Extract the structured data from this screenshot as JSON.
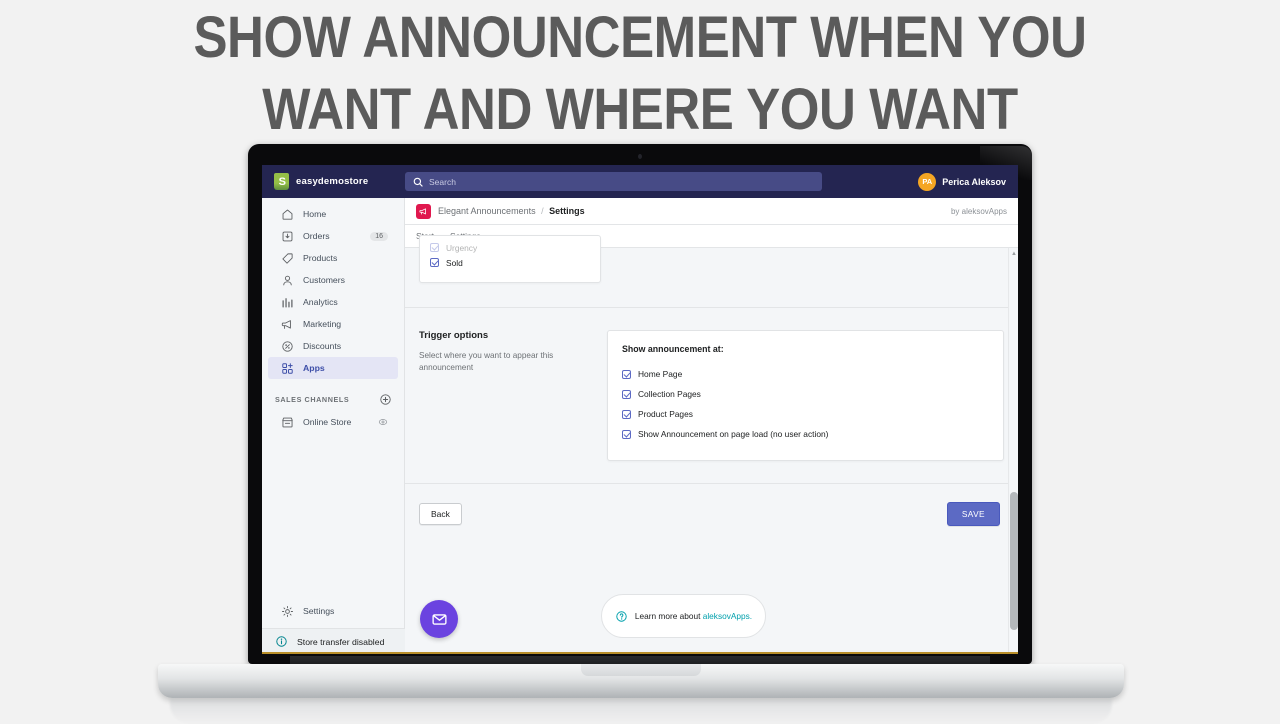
{
  "headline": {
    "line1": "SHOW ANNOUNCEMENT WHEN YOU",
    "line2": "WANT AND WHERE YOU WANT",
    "color": "#5b5b5b"
  },
  "topbar": {
    "brand_name": "easydemostore",
    "logo_icon": "shopify-bag-icon",
    "search": {
      "icon": "search-icon",
      "placeholder": "Search",
      "value": ""
    },
    "user": {
      "initials": "PA",
      "name": "Perica Aleksov",
      "avatar_color": "#f5a623"
    },
    "background": "#242551",
    "search_background": "#474b86"
  },
  "sidebar": {
    "items": [
      {
        "label": "Home",
        "icon": "home-icon",
        "badge": "",
        "active": false
      },
      {
        "label": "Orders",
        "icon": "orders-icon",
        "badge": "16",
        "active": false
      },
      {
        "label": "Products",
        "icon": "products-tag-icon",
        "badge": "",
        "active": false
      },
      {
        "label": "Customers",
        "icon": "customers-icon",
        "badge": "",
        "active": false
      },
      {
        "label": "Analytics",
        "icon": "analytics-bars-icon",
        "badge": "",
        "active": false
      },
      {
        "label": "Marketing",
        "icon": "marketing-megaphone-icon",
        "badge": "",
        "active": false
      },
      {
        "label": "Discounts",
        "icon": "discounts-percent-icon",
        "badge": "",
        "active": false
      },
      {
        "label": "Apps",
        "icon": "apps-grid-icon",
        "badge": "",
        "active": true
      }
    ],
    "channels_heading": "SALES CHANNELS",
    "channels_add_icon": "plus-circle-icon",
    "channels": [
      {
        "label": "Online Store",
        "icon": "storefront-icon",
        "trailing_icon": "eye-icon"
      }
    ],
    "settings": {
      "label": "Settings",
      "icon": "gear-icon"
    },
    "store_transfer": {
      "label": "Store transfer disabled",
      "icon": "info-circle-icon",
      "icon_color": "#00848e"
    },
    "active_background": "#e4e5f5",
    "active_color": "#3d4ea8"
  },
  "app": {
    "icon": "megaphone-icon",
    "icon_color": "#e0184e",
    "breadcrumb_root": "Elegant Announcements",
    "breadcrumb_sep": "/",
    "breadcrumb_current": "Settings",
    "byline": "by aleksovApps",
    "tabs": [
      {
        "label": "Start",
        "active": false
      },
      {
        "label": "Settings",
        "active": false
      }
    ]
  },
  "sold_card": {
    "clipped_item": {
      "label": "Urgency",
      "checked": true
    },
    "items": [
      {
        "label": "Sold",
        "checked": true
      }
    ]
  },
  "trigger": {
    "title": "Trigger options",
    "description": "Select where you want to appear this announcement",
    "card_title": "Show announcement at:",
    "options": [
      {
        "label": "Home Page",
        "checked": true
      },
      {
        "label": "Collection Pages",
        "checked": true
      },
      {
        "label": "Product Pages",
        "checked": true
      },
      {
        "label": "Show Announcement on page load (no user action)",
        "checked": true
      }
    ]
  },
  "actions": {
    "back_label": "Back",
    "save_label": "SAVE",
    "save_color": "#5c6ac4"
  },
  "learn_more": {
    "icon": "question-circle-icon",
    "text": "Learn more about ",
    "link_text": "aleksovApps.",
    "link_color": "#00a0ac"
  },
  "chat_fab": {
    "icon": "envelope-icon",
    "color": "#6b43e0"
  },
  "scrollbar": {
    "up_arrow": "▲",
    "down_arrow": "▼"
  }
}
